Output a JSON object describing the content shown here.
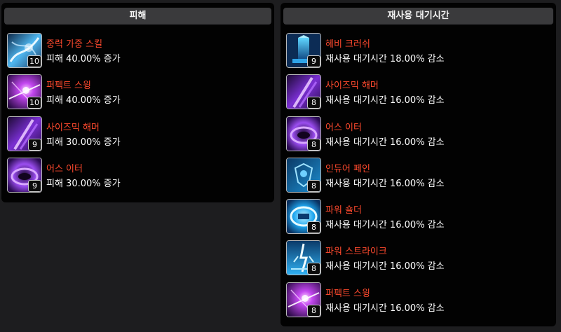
{
  "damage_panel": {
    "title": "피해",
    "skills": [
      {
        "name": "중력 가중 스킬",
        "effect": "피해 40.00% 증가",
        "level": "10",
        "icon": "gravity-skill-icon"
      },
      {
        "name": "퍼펙트 스윙",
        "effect": "피해 40.00% 증가",
        "level": "10",
        "icon": "perfect-swing-icon"
      },
      {
        "name": "사이즈믹 해머",
        "effect": "피해 30.00% 증가",
        "level": "9",
        "icon": "seismic-hammer-icon"
      },
      {
        "name": "어스 이터",
        "effect": "피해 30.00% 증가",
        "level": "9",
        "icon": "earth-eater-icon"
      }
    ]
  },
  "cooldown_panel": {
    "title": "재사용 대기시간",
    "skills": [
      {
        "name": "헤비 크러쉬",
        "effect": "재사용 대기시간 18.00% 감소",
        "level": "9",
        "icon": "heavy-crush-icon"
      },
      {
        "name": "사이즈믹 해머",
        "effect": "재사용 대기시간 16.00% 감소",
        "level": "8",
        "icon": "seismic-hammer-icon"
      },
      {
        "name": "어스 이터",
        "effect": "재사용 대기시간 16.00% 감소",
        "level": "8",
        "icon": "earth-eater-icon"
      },
      {
        "name": "인듀어 페인",
        "effect": "재사용 대기시간 16.00% 감소",
        "level": "8",
        "icon": "endure-pain-icon"
      },
      {
        "name": "파워 숄더",
        "effect": "재사용 대기시간 16.00% 감소",
        "level": "8",
        "icon": "power-shoulder-icon"
      },
      {
        "name": "파워 스트라이크",
        "effect": "재사용 대기시간 16.00% 감소",
        "level": "8",
        "icon": "power-strike-icon"
      },
      {
        "name": "퍼펙트 스윙",
        "effect": "재사용 대기시간 16.00% 감소",
        "level": "8",
        "icon": "perfect-swing-icon"
      }
    ]
  },
  "colors": {
    "skill_name": "#ff4a2e",
    "effect_text": "#ffffff",
    "panel_bg": "#020202",
    "header_bg": "#3a3a3c",
    "page_bg": "#1d1d1f"
  }
}
